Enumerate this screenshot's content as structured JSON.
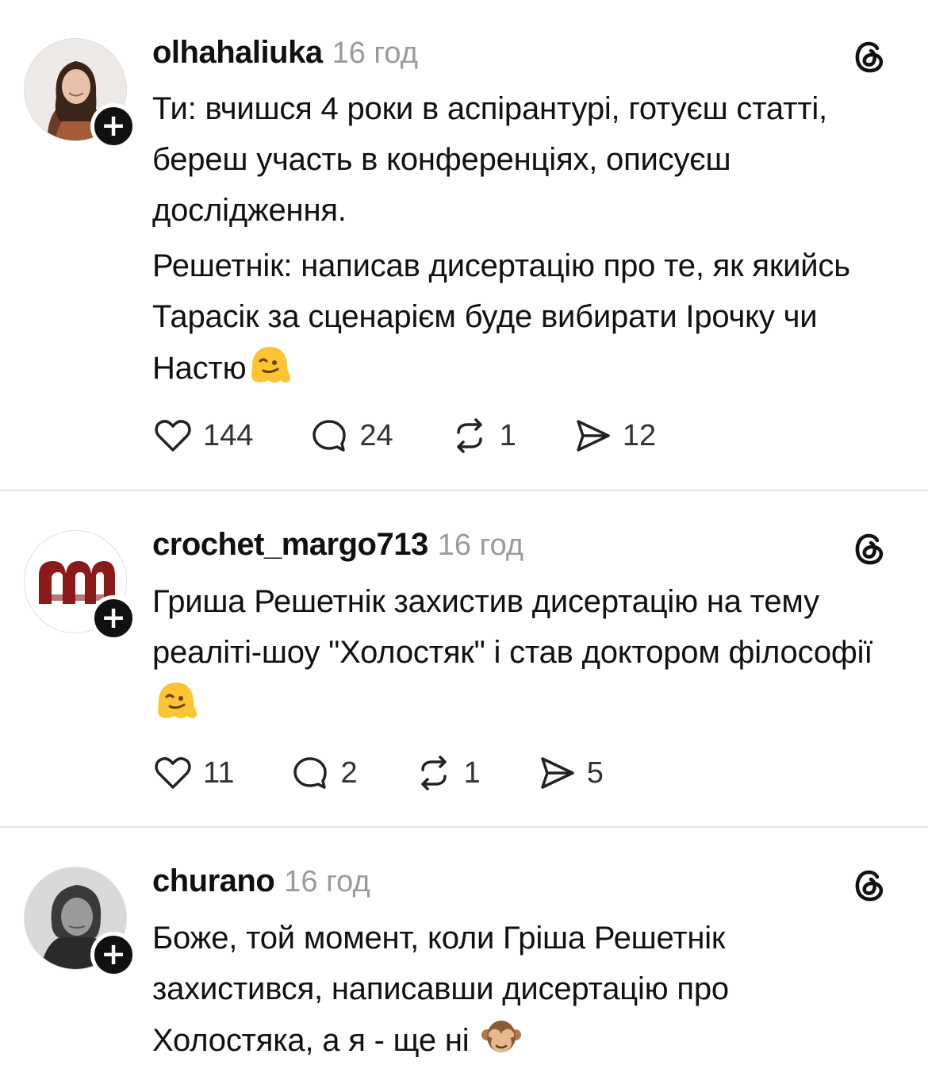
{
  "posts": [
    {
      "username": "olhahaliuka",
      "time": "16 год",
      "paragraphs": [
        "Ти: вчишся 4 роки в аспірантурі, готуєш статті, береш участь в конференціях, описуєш дослідження.",
        "Решетнік: написав дисертацію про те, як якийсь Тарасік за сценарієм буде вибирати Ірочку чи Настю"
      ],
      "emoji": "melting-face",
      "likes": "144",
      "replies": "24",
      "reposts": "1",
      "shares": "12"
    },
    {
      "username": "crochet_margo713",
      "time": "16 год",
      "paragraphs": [
        "Гриша Решетнік захистив дисертацію на тему реаліті-шоу \"Холостяк\" і став доктором філософії"
      ],
      "emoji": "melting-face",
      "likes": "11",
      "replies": "2",
      "reposts": "1",
      "shares": "5"
    },
    {
      "username": "churano",
      "time": "16 год",
      "paragraphs": [
        "Боже, той момент, коли Гріша Решетнік захистився, написавши дисертацію про Холостяка, а я - ще ні "
      ],
      "emoji": "see-no-evil-monkey"
    }
  ],
  "colors": {
    "text": "#111111",
    "muted": "#9a9a9a",
    "divider": "#e3e3e3",
    "badge": "#111111"
  }
}
